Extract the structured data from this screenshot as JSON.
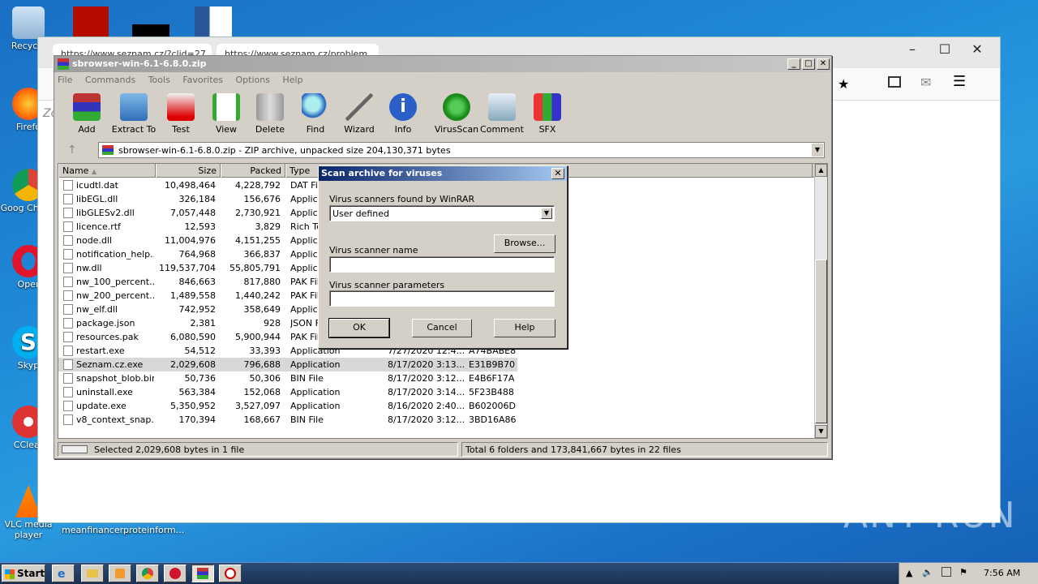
{
  "desktop": {
    "icons": [
      {
        "label": "Recycle"
      },
      {
        "label": "Firefo"
      },
      {
        "label": "Goog Chrom"
      },
      {
        "label": "Oper"
      },
      {
        "label": "Skyp"
      },
      {
        "label": "CClear"
      },
      {
        "label": "VLC media player"
      },
      {
        "label": "meanfinancer..."
      },
      {
        "label": "proteinform..."
      }
    ]
  },
  "browser": {
    "tabs": [
      {
        "label": "https://www.seznam.cz/?clid=27..."
      },
      {
        "label": "https://www.seznam.cz/problem..."
      }
    ],
    "page_hint": "Zo"
  },
  "winrar": {
    "title": "sbrowser-win-6.1-6.8.0.zip",
    "menu": [
      "File",
      "Commands",
      "Tools",
      "Favorites",
      "Options",
      "Help"
    ],
    "tools": [
      "Add",
      "Extract To",
      "Test",
      "View",
      "Delete",
      "Find",
      "Wizard",
      "Info",
      "VirusScan",
      "Comment",
      "SFX"
    ],
    "address": "sbrowser-win-6.1-6.8.0.zip - ZIP archive, unpacked size 204,130,371 bytes",
    "columns": [
      "Name",
      "Size",
      "Packed",
      "Type"
    ],
    "files": [
      {
        "name": "icudtl.dat",
        "size": "10,498,464",
        "packed": "4,228,792",
        "type": "DAT Fil",
        "modified": "",
        "crc": ""
      },
      {
        "name": "libEGL.dll",
        "size": "326,184",
        "packed": "156,676",
        "type": "Applica",
        "modified": "",
        "crc": ""
      },
      {
        "name": "libGLESv2.dll",
        "size": "7,057,448",
        "packed": "2,730,921",
        "type": "Applica",
        "modified": "",
        "crc": ""
      },
      {
        "name": "licence.rtf",
        "size": "12,593",
        "packed": "3,829",
        "type": "Rich Te",
        "modified": "",
        "crc": ""
      },
      {
        "name": "node.dll",
        "size": "11,004,976",
        "packed": "4,151,255",
        "type": "Applica",
        "modified": "",
        "crc": ""
      },
      {
        "name": "notification_help...",
        "size": "764,968",
        "packed": "366,837",
        "type": "Applica",
        "modified": "",
        "crc": ""
      },
      {
        "name": "nw.dll",
        "size": "119,537,704",
        "packed": "55,805,791",
        "type": "Applica",
        "modified": "",
        "crc": ""
      },
      {
        "name": "nw_100_percent...",
        "size": "846,663",
        "packed": "817,880",
        "type": "PAK Fil",
        "modified": "",
        "crc": ""
      },
      {
        "name": "nw_200_percent...",
        "size": "1,489,558",
        "packed": "1,440,242",
        "type": "PAK Fil",
        "modified": "",
        "crc": ""
      },
      {
        "name": "nw_elf.dll",
        "size": "742,952",
        "packed": "358,649",
        "type": "Applica",
        "modified": "",
        "crc": ""
      },
      {
        "name": "package.json",
        "size": "2,381",
        "packed": "928",
        "type": "JSON F",
        "modified": "",
        "crc": ""
      },
      {
        "name": "resources.pak",
        "size": "6,080,590",
        "packed": "5,900,944",
        "type": "PAK Fil",
        "modified": "",
        "crc": ""
      },
      {
        "name": "restart.exe",
        "size": "54,512",
        "packed": "33,393",
        "type": "Application",
        "modified": "7/27/2020 12:4...",
        "crc": "A74BABE8"
      },
      {
        "name": "Seznam.cz.exe",
        "size": "2,029,608",
        "packed": "796,688",
        "type": "Application",
        "modified": "8/17/2020 3:13...",
        "crc": "E31B9B70"
      },
      {
        "name": "snapshot_blob.bin",
        "size": "50,736",
        "packed": "50,306",
        "type": "BIN File",
        "modified": "8/17/2020 3:12...",
        "crc": "E4B6F17A"
      },
      {
        "name": "uninstall.exe",
        "size": "563,384",
        "packed": "152,068",
        "type": "Application",
        "modified": "8/17/2020 3:14...",
        "crc": "5F23B488"
      },
      {
        "name": "update.exe",
        "size": "5,350,952",
        "packed": "3,527,097",
        "type": "Application",
        "modified": "8/16/2020 2:40...",
        "crc": "B602006D"
      },
      {
        "name": "v8_context_snap...",
        "size": "170,394",
        "packed": "168,667",
        "type": "BIN File",
        "modified": "8/17/2020 3:12...",
        "crc": "3BD16A86"
      }
    ],
    "status_left": "Selected 2,029,608 bytes in 1 file",
    "status_right": "Total 6 folders and 173,841,667 bytes in 22 files"
  },
  "dialog": {
    "title": "Scan archive for viruses",
    "scanners_label": "Virus scanners found by WinRAR",
    "scanner_selected": "User defined",
    "browse_label": "Browse...",
    "name_label": "Virus scanner name",
    "name_value": "",
    "params_label": "Virus scanner parameters",
    "params_value": "",
    "ok_label": "OK",
    "cancel_label": "Cancel",
    "help_label": "Help"
  },
  "taskbar": {
    "start_label": "Start",
    "clock": "7:56 AM"
  },
  "watermark": "ANY RUN"
}
